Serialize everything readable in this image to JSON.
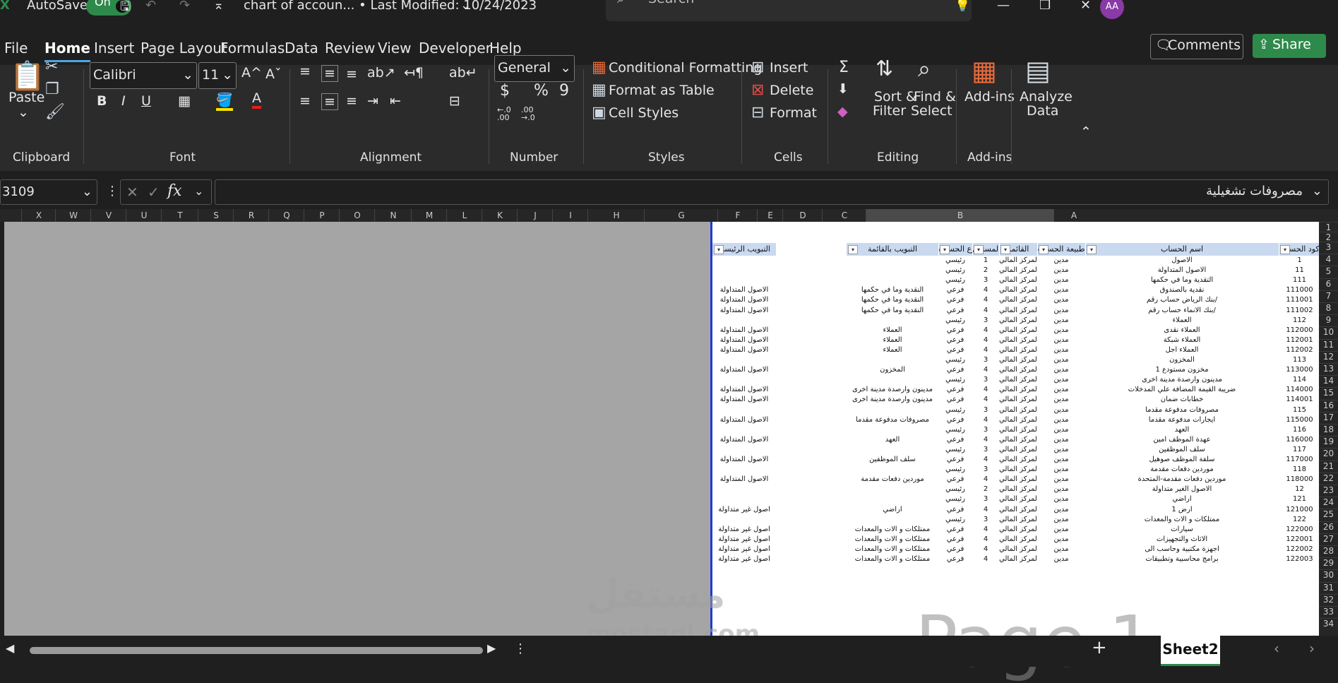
{
  "titlebar": {
    "autosave_label": "AutoSave",
    "autosave_state": "On",
    "file_title": "chart of accoun... • Last Modified: 10/24/2023",
    "search_placeholder": "Search",
    "avatar_initials": "AA"
  },
  "menu": {
    "tabs": [
      "File",
      "Home",
      "Insert",
      "Page Layout",
      "Formulas",
      "Data",
      "Review",
      "View",
      "Developer",
      "Help"
    ],
    "active_tab": "Home",
    "comments": "Comments",
    "share": "Share"
  },
  "ribbon": {
    "clipboard": {
      "paste": "Paste",
      "label": "Clipboard"
    },
    "font": {
      "name": "Calibri",
      "size": "11",
      "bold": "B",
      "italic": "I",
      "underline": "U",
      "label": "Font"
    },
    "alignment": {
      "label": "Alignment"
    },
    "number": {
      "format": "General",
      "currency": "$",
      "percent": "%",
      "comma": "9",
      "inc_decimal": "←.0 .00",
      "dec_decimal": ".00 →.0",
      "label": "Number"
    },
    "styles": {
      "conditional": "Conditional Formatting",
      "format_table": "Format as Table",
      "cell_styles": "Cell Styles",
      "label": "Styles"
    },
    "cells": {
      "insert": "Insert",
      "delete": "Delete",
      "format": "Format",
      "label": "Cells"
    },
    "editing": {
      "sort": "Sort &",
      "filter": "Filter",
      "find": "Find &",
      "select": "Select",
      "label": "Editing"
    },
    "addins": {
      "addins": "Add-ins",
      "label": "Add-ins"
    },
    "analyze": {
      "line1": "Analyze",
      "line2": "Data"
    }
  },
  "formula_bar": {
    "name_box": "3109",
    "fx": "fx",
    "content": "مصروفات تشغيلية"
  },
  "columns": [
    "X",
    "W",
    "V",
    "U",
    "T",
    "S",
    "R",
    "Q",
    "P",
    "O",
    "N",
    "M",
    "L",
    "K",
    "J",
    "I",
    "H",
    "G",
    "F",
    "E",
    "D",
    "C",
    "B",
    "A"
  ],
  "rows": [
    "1",
    "2",
    "3",
    "4",
    "5",
    "6",
    "7",
    "8",
    "9",
    "10",
    "11",
    "12",
    "13",
    "14",
    "15",
    "16",
    "17",
    "18",
    "19",
    "20",
    "21",
    "22",
    "23",
    "24",
    "25",
    "26",
    "27",
    "28",
    "29",
    "30",
    "31",
    "32",
    "33",
    "34"
  ],
  "table": {
    "headers": [
      "كود الحساب",
      "اسم الحساب",
      "طبيعة الحساب",
      "القائمة",
      "المستوى",
      "نوع الحساب",
      "التبويب بالقائمة",
      "التبويب الرئيسي"
    ],
    "data_rows": [
      [
        "1",
        "الاصول",
        "مدين",
        "المركز المالي",
        "1",
        "رئيسي",
        "",
        ""
      ],
      [
        "11",
        "الاصول المتداولة",
        "مدين",
        "المركز المالي",
        "2",
        "رئيسي",
        "",
        ""
      ],
      [
        "111",
        "التقدية وما في حكمها",
        "مدين",
        "المركز المالي",
        "3",
        "رئيسي",
        "",
        ""
      ],
      [
        "111000",
        "نقدية بالصندوق",
        "مدين",
        "المركز المالي",
        "4",
        "فرعي",
        "النقدية وما في حكمها",
        "الاصول المتداولة"
      ],
      [
        "111001",
        "بنك الرياض حساب رقم/",
        "مدين",
        "المركز المالي",
        "4",
        "فرعي",
        "النقدية وما في حكمها",
        "الاصول المتداولة"
      ],
      [
        "111002",
        "بنك الانماء حساب رقم/",
        "مدين",
        "المركز المالي",
        "4",
        "فرعي",
        "النقدية وما في حكمها",
        "الاصول المتداولة"
      ],
      [
        "112",
        "العملاء",
        "مدين",
        "المركز المالي",
        "3",
        "رئيسي",
        "",
        ""
      ],
      [
        "112000",
        "العملاء نقدى",
        "مدين",
        "المركز المالي",
        "4",
        "فرعي",
        "العملاء",
        "الاصول المتداولة"
      ],
      [
        "112001",
        "العملاء شبكة",
        "مدين",
        "المركز المالي",
        "4",
        "فرعي",
        "العملاء",
        "الاصول المتداولة"
      ],
      [
        "112002",
        "العملاء اجل",
        "مدين",
        "المركز المالي",
        "4",
        "فرعي",
        "العملاء",
        "الاصول المتداولة"
      ],
      [
        "113",
        "المخزون",
        "مدين",
        "المركز المالي",
        "3",
        "رئيسي",
        "",
        ""
      ],
      [
        "113000",
        "مخزون مستودع 1",
        "مدين",
        "المركز المالي",
        "4",
        "فرعي",
        "المخزون",
        "الاصول المتداولة"
      ],
      [
        "114",
        "مدينون وارصدة مدينة اخرى",
        "مدين",
        "المركز المالي",
        "3",
        "رئيسي",
        "",
        ""
      ],
      [
        "114000",
        "ضريبة القيمة المضافة علي المدخلات",
        "مدين",
        "المركز المالي",
        "4",
        "فرعي",
        "مدينون وارصدة مدينة اخرى",
        "الاصول المتداولة"
      ],
      [
        "114001",
        "خطابات ضمان",
        "مدين",
        "المركز المالي",
        "4",
        "فرعي",
        "مدينون وارصدة مدينة اخرى",
        "الاصول المتداولة"
      ],
      [
        "115",
        "مصروفات مدفوعة مقدما",
        "مدين",
        "المركز المالي",
        "3",
        "رئيسي",
        "",
        ""
      ],
      [
        "115000",
        "ايجارات مدفوعة مقدما",
        "مدين",
        "المركز المالي",
        "4",
        "فرعي",
        "مصروفات مدفوعة مقدما",
        "الاصول المتداولة"
      ],
      [
        "116",
        "العهد",
        "مدين",
        "المركز المالي",
        "3",
        "رئيسي",
        "",
        ""
      ],
      [
        "116000",
        "عهدة الموظف امين",
        "مدين",
        "المركز المالي",
        "4",
        "فرعي",
        "العهد",
        "الاصول المتداولة"
      ],
      [
        "117",
        "سلف الموظفين",
        "مدين",
        "المركز المالي",
        "3",
        "رئيسي",
        "",
        ""
      ],
      [
        "117000",
        "سلفة الموظف صوهيل",
        "مدين",
        "المركز المالي",
        "4",
        "فرعي",
        "سلف الموظفين",
        "الاصول المتداولة"
      ],
      [
        "118",
        "موردين دفعات مقدمة",
        "مدين",
        "المركز المالي",
        "3",
        "رئيسي",
        "",
        ""
      ],
      [
        "118000",
        "موردين دفعات مقدمة-المتحدة",
        "مدين",
        "المركز المالي",
        "4",
        "فرعي",
        "موردين دفعات مقدمة",
        "الاصول المتداولة"
      ],
      [
        "12",
        "الاصول الغير متداولة",
        "مدين",
        "المركز المالي",
        "2",
        "رئيسي",
        "",
        ""
      ],
      [
        "121",
        "اراضي",
        "مدين",
        "المركز المالي",
        "3",
        "رئيسي",
        "",
        ""
      ],
      [
        "121000",
        "ارض 1",
        "مدين",
        "المركز المالي",
        "4",
        "فرعي",
        "اراضي",
        "اصول غير متداولة"
      ],
      [
        "122",
        "ممتلكات و الات والمعدات",
        "مدين",
        "المركز المالي",
        "3",
        "رئيسي",
        "",
        ""
      ],
      [
        "122000",
        "سيارات",
        "مدين",
        "المركز المالي",
        "4",
        "فرعي",
        "ممتلكات و الات والمعدات",
        "اصول غير متداولة"
      ],
      [
        "122001",
        "الاثاث والتجهيزات",
        "مدين",
        "المركز المالي",
        "4",
        "فرعي",
        "ممتلكات و الات والمعدات",
        "اصول غير متداولة"
      ],
      [
        "122002",
        "اجهزة مكتبية وحاسب الى",
        "مدين",
        "المركز المالي",
        "4",
        "فرعي",
        "ممتلكات و الات والمعدات",
        "اصول غير متداولة"
      ],
      [
        "122003",
        "برامج محاسبية وتطبيقات",
        "مدين",
        "المركز المالي",
        "4",
        "فرعي",
        "ممتلكات و الات والمعدات",
        "اصول غير متداولة"
      ]
    ]
  },
  "page_watermark": "Page 1",
  "site_watermark": {
    "arabic": "مستقل",
    "latin": "mostaql.com"
  },
  "sheet_tab": "Sheet2"
}
